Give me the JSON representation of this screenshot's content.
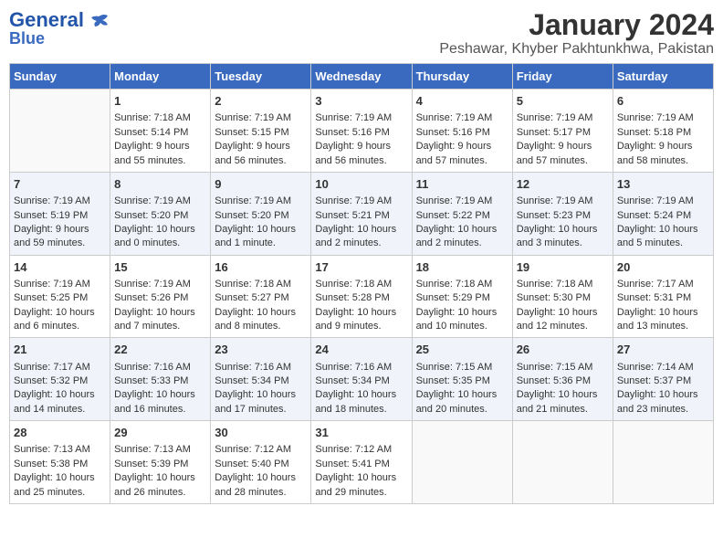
{
  "header": {
    "logo_line1": "General",
    "logo_line2": "Blue",
    "title": "January 2024",
    "subtitle": "Peshawar, Khyber Pakhtunkhwa, Pakistan"
  },
  "weekdays": [
    "Sunday",
    "Monday",
    "Tuesday",
    "Wednesday",
    "Thursday",
    "Friday",
    "Saturday"
  ],
  "weeks": [
    [
      {
        "day": "",
        "lines": []
      },
      {
        "day": "1",
        "lines": [
          "Sunrise: 7:18 AM",
          "Sunset: 5:14 PM",
          "Daylight: 9 hours",
          "and 55 minutes."
        ]
      },
      {
        "day": "2",
        "lines": [
          "Sunrise: 7:19 AM",
          "Sunset: 5:15 PM",
          "Daylight: 9 hours",
          "and 56 minutes."
        ]
      },
      {
        "day": "3",
        "lines": [
          "Sunrise: 7:19 AM",
          "Sunset: 5:16 PM",
          "Daylight: 9 hours",
          "and 56 minutes."
        ]
      },
      {
        "day": "4",
        "lines": [
          "Sunrise: 7:19 AM",
          "Sunset: 5:16 PM",
          "Daylight: 9 hours",
          "and 57 minutes."
        ]
      },
      {
        "day": "5",
        "lines": [
          "Sunrise: 7:19 AM",
          "Sunset: 5:17 PM",
          "Daylight: 9 hours",
          "and 57 minutes."
        ]
      },
      {
        "day": "6",
        "lines": [
          "Sunrise: 7:19 AM",
          "Sunset: 5:18 PM",
          "Daylight: 9 hours",
          "and 58 minutes."
        ]
      }
    ],
    [
      {
        "day": "7",
        "lines": [
          "Sunrise: 7:19 AM",
          "Sunset: 5:19 PM",
          "Daylight: 9 hours",
          "and 59 minutes."
        ]
      },
      {
        "day": "8",
        "lines": [
          "Sunrise: 7:19 AM",
          "Sunset: 5:20 PM",
          "Daylight: 10 hours",
          "and 0 minutes."
        ]
      },
      {
        "day": "9",
        "lines": [
          "Sunrise: 7:19 AM",
          "Sunset: 5:20 PM",
          "Daylight: 10 hours",
          "and 1 minute."
        ]
      },
      {
        "day": "10",
        "lines": [
          "Sunrise: 7:19 AM",
          "Sunset: 5:21 PM",
          "Daylight: 10 hours",
          "and 2 minutes."
        ]
      },
      {
        "day": "11",
        "lines": [
          "Sunrise: 7:19 AM",
          "Sunset: 5:22 PM",
          "Daylight: 10 hours",
          "and 2 minutes."
        ]
      },
      {
        "day": "12",
        "lines": [
          "Sunrise: 7:19 AM",
          "Sunset: 5:23 PM",
          "Daylight: 10 hours",
          "and 3 minutes."
        ]
      },
      {
        "day": "13",
        "lines": [
          "Sunrise: 7:19 AM",
          "Sunset: 5:24 PM",
          "Daylight: 10 hours",
          "and 5 minutes."
        ]
      }
    ],
    [
      {
        "day": "14",
        "lines": [
          "Sunrise: 7:19 AM",
          "Sunset: 5:25 PM",
          "Daylight: 10 hours",
          "and 6 minutes."
        ]
      },
      {
        "day": "15",
        "lines": [
          "Sunrise: 7:19 AM",
          "Sunset: 5:26 PM",
          "Daylight: 10 hours",
          "and 7 minutes."
        ]
      },
      {
        "day": "16",
        "lines": [
          "Sunrise: 7:18 AM",
          "Sunset: 5:27 PM",
          "Daylight: 10 hours",
          "and 8 minutes."
        ]
      },
      {
        "day": "17",
        "lines": [
          "Sunrise: 7:18 AM",
          "Sunset: 5:28 PM",
          "Daylight: 10 hours",
          "and 9 minutes."
        ]
      },
      {
        "day": "18",
        "lines": [
          "Sunrise: 7:18 AM",
          "Sunset: 5:29 PM",
          "Daylight: 10 hours",
          "and 10 minutes."
        ]
      },
      {
        "day": "19",
        "lines": [
          "Sunrise: 7:18 AM",
          "Sunset: 5:30 PM",
          "Daylight: 10 hours",
          "and 12 minutes."
        ]
      },
      {
        "day": "20",
        "lines": [
          "Sunrise: 7:17 AM",
          "Sunset: 5:31 PM",
          "Daylight: 10 hours",
          "and 13 minutes."
        ]
      }
    ],
    [
      {
        "day": "21",
        "lines": [
          "Sunrise: 7:17 AM",
          "Sunset: 5:32 PM",
          "Daylight: 10 hours",
          "and 14 minutes."
        ]
      },
      {
        "day": "22",
        "lines": [
          "Sunrise: 7:16 AM",
          "Sunset: 5:33 PM",
          "Daylight: 10 hours",
          "and 16 minutes."
        ]
      },
      {
        "day": "23",
        "lines": [
          "Sunrise: 7:16 AM",
          "Sunset: 5:34 PM",
          "Daylight: 10 hours",
          "and 17 minutes."
        ]
      },
      {
        "day": "24",
        "lines": [
          "Sunrise: 7:16 AM",
          "Sunset: 5:34 PM",
          "Daylight: 10 hours",
          "and 18 minutes."
        ]
      },
      {
        "day": "25",
        "lines": [
          "Sunrise: 7:15 AM",
          "Sunset: 5:35 PM",
          "Daylight: 10 hours",
          "and 20 minutes."
        ]
      },
      {
        "day": "26",
        "lines": [
          "Sunrise: 7:15 AM",
          "Sunset: 5:36 PM",
          "Daylight: 10 hours",
          "and 21 minutes."
        ]
      },
      {
        "day": "27",
        "lines": [
          "Sunrise: 7:14 AM",
          "Sunset: 5:37 PM",
          "Daylight: 10 hours",
          "and 23 minutes."
        ]
      }
    ],
    [
      {
        "day": "28",
        "lines": [
          "Sunrise: 7:13 AM",
          "Sunset: 5:38 PM",
          "Daylight: 10 hours",
          "and 25 minutes."
        ]
      },
      {
        "day": "29",
        "lines": [
          "Sunrise: 7:13 AM",
          "Sunset: 5:39 PM",
          "Daylight: 10 hours",
          "and 26 minutes."
        ]
      },
      {
        "day": "30",
        "lines": [
          "Sunrise: 7:12 AM",
          "Sunset: 5:40 PM",
          "Daylight: 10 hours",
          "and 28 minutes."
        ]
      },
      {
        "day": "31",
        "lines": [
          "Sunrise: 7:12 AM",
          "Sunset: 5:41 PM",
          "Daylight: 10 hours",
          "and 29 minutes."
        ]
      },
      {
        "day": "",
        "lines": []
      },
      {
        "day": "",
        "lines": []
      },
      {
        "day": "",
        "lines": []
      }
    ]
  ]
}
